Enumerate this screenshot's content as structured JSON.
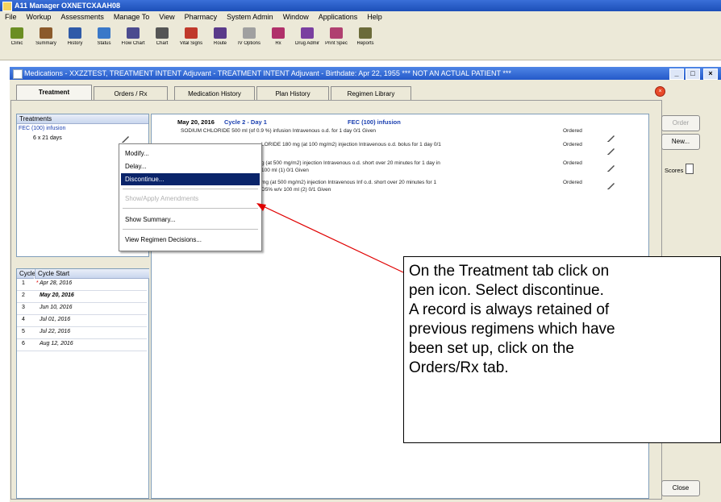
{
  "app": {
    "title": "A11 Manager OXNETCXAAH08",
    "menu": [
      "File",
      "Workup",
      "Assessments",
      "Manage To",
      "View",
      "Pharmacy",
      "System Admin",
      "Window",
      "Applications",
      "Help"
    ],
    "toolbar": [
      {
        "label": "Clinic",
        "icon": "clinic-icon",
        "color": "#6b8e23"
      },
      {
        "label": "Summary",
        "icon": "summary-icon",
        "color": "#8b5a2b"
      },
      {
        "label": "History",
        "icon": "history-icon",
        "color": "#2f5aa8"
      },
      {
        "label": "Status",
        "icon": "status-icon",
        "color": "#3a78c8"
      },
      {
        "label": "Flow Chart",
        "icon": "flowchart-icon",
        "color": "#4b4b8f"
      },
      {
        "label": "Chart",
        "icon": "chart-icon",
        "color": "#555555"
      },
      {
        "label": "Vital Signs",
        "icon": "vitals-icon",
        "color": "#c0392b"
      },
      {
        "label": "Route",
        "icon": "route-icon",
        "color": "#5a3a8a"
      },
      {
        "label": "IV Options",
        "icon": "iv-icon",
        "color": "#a0a0a0"
      },
      {
        "label": "Rx",
        "icon": "rx-icon",
        "color": "#b0306a"
      },
      {
        "label": "Drug Admin",
        "icon": "drug-admin-icon",
        "color": "#7a3fa0"
      },
      {
        "label": "Print Spec",
        "icon": "print-icon",
        "color": "#b04070"
      },
      {
        "label": "Reports",
        "icon": "reports-icon",
        "color": "#6b6b3a"
      }
    ]
  },
  "window": {
    "title": "Medications - XXZZTEST, TREATMENT INTENT Adjuvant - TREATMENT INTENT Adjuvant - Birthdate: Apr 22, 1955 *** NOT AN ACTUAL PATIENT ***",
    "tabs": [
      "Treatment",
      "Orders / Rx",
      "Medication History",
      "Plan History",
      "Regimen Library"
    ]
  },
  "treatments": {
    "header": "Treatments",
    "items": [
      "FEC (100) infusion",
      "6 x 21 days"
    ]
  },
  "cycles": {
    "headers": [
      "Cycle",
      "Cycle Start"
    ],
    "rows": [
      {
        "cycle": "1",
        "start": "Apr 28, 2016"
      },
      {
        "cycle": "2",
        "start": "May 20, 2016"
      },
      {
        "cycle": "3",
        "start": "Jun 10, 2016"
      },
      {
        "cycle": "4",
        "start": "Jul 01, 2016"
      },
      {
        "cycle": "5",
        "start": "Jul 22, 2016"
      },
      {
        "cycle": "6",
        "start": "Aug 12, 2016"
      }
    ]
  },
  "day_header": {
    "date": "May 20, 2016",
    "cycle": "Cycle 2 - Day 1",
    "regimen": "FEC (100) infusion"
  },
  "orders": [
    {
      "text": "SODIUM CHLORIDE 500 ml (of 0.9 %) infusion Intravenous o.d. for 1 day   0/1 Given",
      "status": "Ordered"
    },
    {
      "text": "LORIDE 180 mg (at 100 mg/m2) injection Intravenous o.d. bolus for 1 day   0/1",
      "status": "Ordered"
    },
    {
      "text": "g (at 500 mg/m2) injection Intravenous o.d. short over 20 minutes for 1 day in",
      "text2": "100 ml (1)   0/1 Given",
      "status": "Ordered"
    },
    {
      "text": "mg (at 500 mg/m2) injection Intravenous Inf o.d. short over 20 minutes for 1",
      "text2": "D5% w/v 100 ml (2)   0/1 Given",
      "status": "Ordered"
    }
  ],
  "right_buttons": {
    "order": "Order",
    "new": "New...",
    "scores": "Scores",
    "close": "Close"
  },
  "context_menu": {
    "items": [
      "Modify...",
      "Delay...",
      "Discontinue...",
      "Show/Apply Amendments",
      "Show Summary...",
      "View Regimen Decisions..."
    ]
  },
  "callout": {
    "lines": [
      "On the Treatment tab click on",
      "pen icon. Select discontinue.",
      "A record is always retained of",
      "previous regimens which have",
      "been set up, click on the",
      "Orders/Rx tab."
    ]
  },
  "colors": {
    "selection": "#0a246a",
    "arrow": "#e00000",
    "titlebar": "#2459c9"
  }
}
